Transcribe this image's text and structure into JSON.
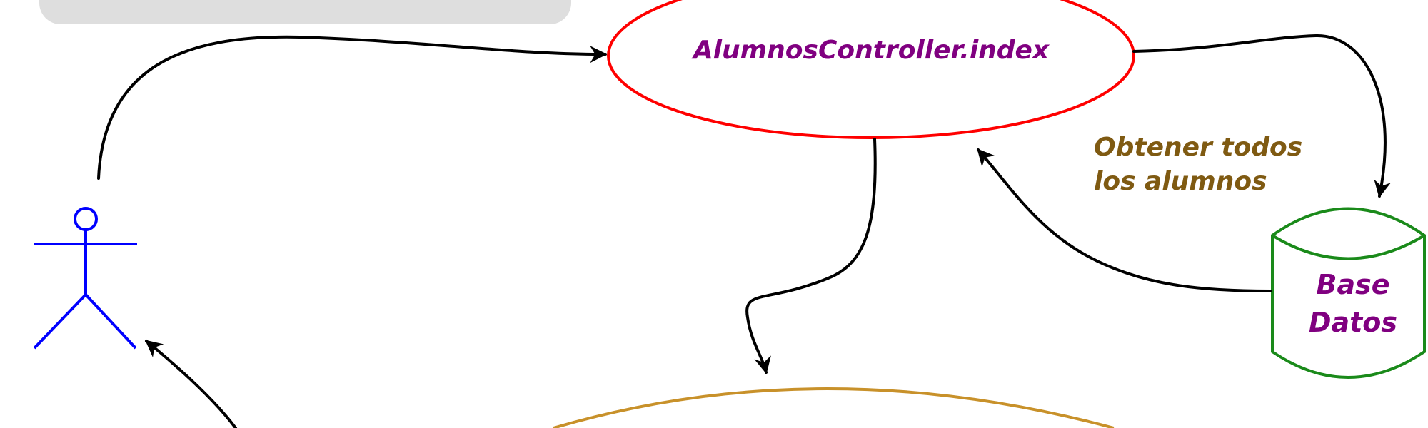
{
  "nodes": {
    "controller": {
      "label": "AlumnosController.index",
      "stroke": "#ff0000",
      "text_color": "#800080"
    },
    "database": {
      "line1": "Base",
      "line2": "Datos",
      "stroke": "#1a8a1a",
      "text_color": "#800080"
    },
    "view": {
      "stroke": "#c8912a"
    },
    "actor": {
      "color": "#0000ff"
    }
  },
  "edges": {
    "db_query_label_line1": "Obtener todos",
    "db_query_label_line2": "los alumnos",
    "label_color": "#7f5a12"
  },
  "decoration": {
    "banner_color": "#dedede"
  }
}
